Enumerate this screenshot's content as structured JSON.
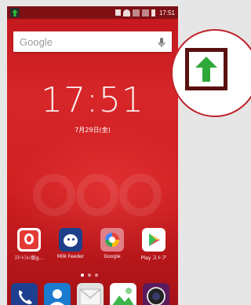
{
  "status_bar": {
    "time": "17:51"
  },
  "search": {
    "label": "Google"
  },
  "clock": {
    "time": "17:51",
    "date": "7月29日(金)"
  },
  "apps": [
    {
      "label": "ｽﾏｰﾄﾌｫﾝ版g...",
      "icon": "goo-app-icon",
      "color": "#e53935"
    },
    {
      "label": "Milk Feeder",
      "icon": "milk-feeder-icon",
      "color": "#1e3f8a"
    },
    {
      "label": "Google",
      "icon": "google-folder-icon",
      "color": "#e07f88"
    },
    {
      "label": "Play ストア",
      "icon": "play-store-icon",
      "color": "#ffffff"
    }
  ],
  "dock": [
    {
      "icon": "phone-icon",
      "color": "#1f3f8f"
    },
    {
      "icon": "contacts-icon",
      "color": "#1b7bd1"
    },
    {
      "icon": "mail-icon",
      "color": "#e0e0e0"
    },
    {
      "icon": "gallery-icon",
      "color": "#ffffff"
    },
    {
      "icon": "camera-icon",
      "color": "#5a1a5c"
    }
  ],
  "callout": {
    "icon": "upload-arrow-icon",
    "accent": "#c0242a"
  }
}
